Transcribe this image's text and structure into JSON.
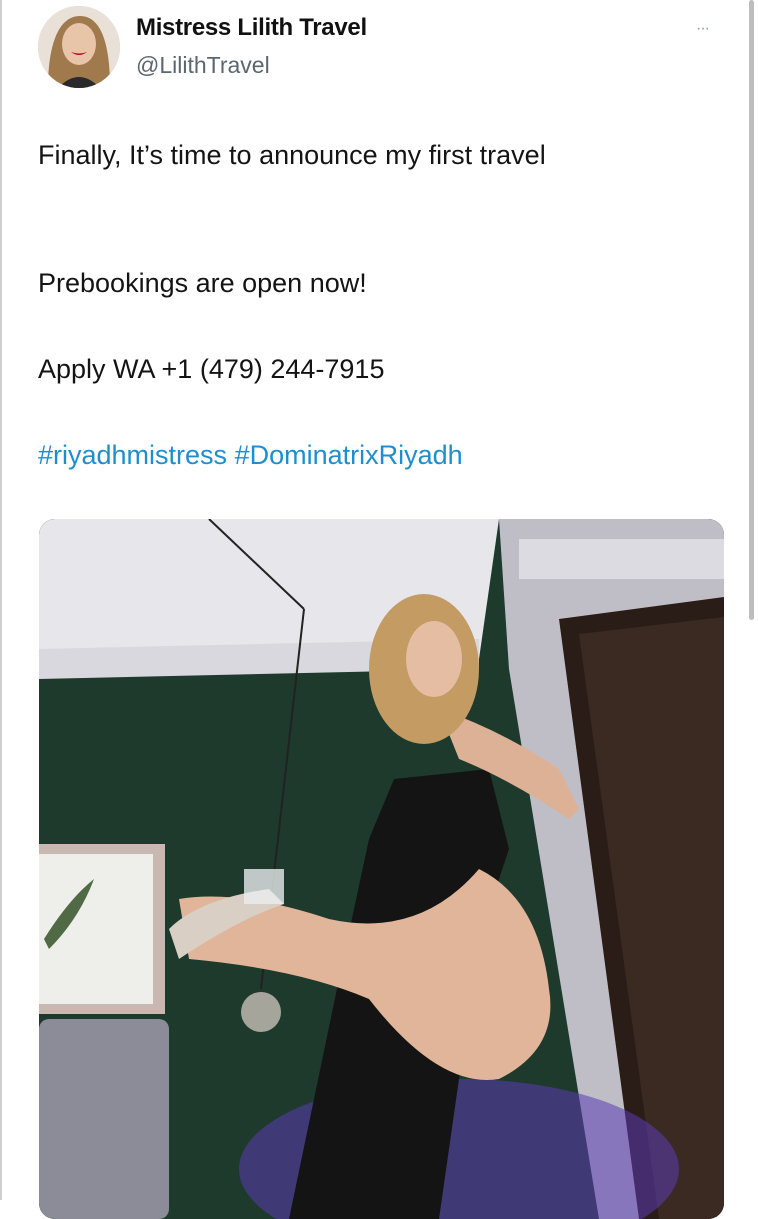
{
  "tweet": {
    "author_name": "Mistress Lilith Travel",
    "author_handle": "@LilithTravel",
    "more_label": "···",
    "lines": [
      "Finally, It’s time to announce my first travel",
      "Prebookings are open now!",
      "Apply WA  +1 (479) 244-7915"
    ],
    "hashtags": [
      "#riyadhmistress",
      "#DominatrixRiyadh"
    ]
  },
  "colors": {
    "link": "#1d8fcf",
    "text": "#141414",
    "muted": "#5b6670"
  },
  "icons": {
    "more": "more-horizontal-icon",
    "avatar": "avatar"
  }
}
